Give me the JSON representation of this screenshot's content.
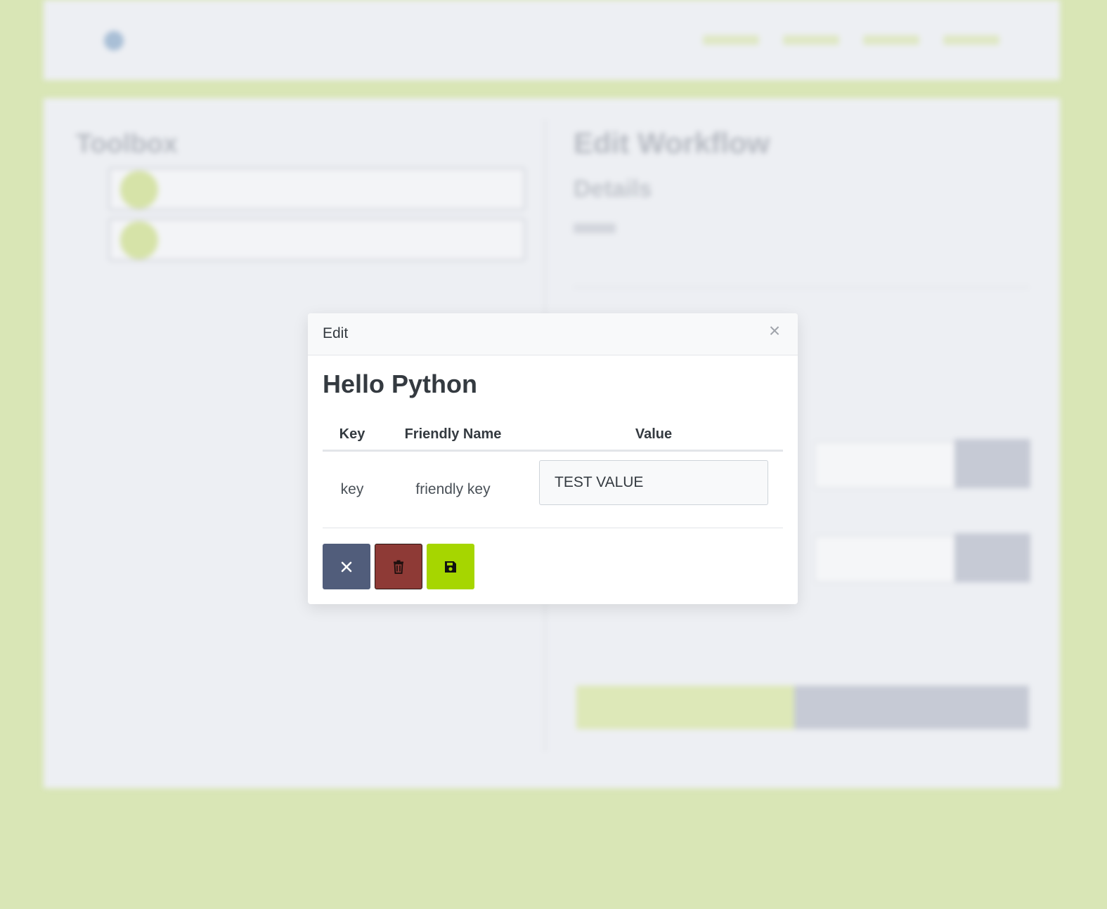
{
  "modal": {
    "title": "Edit",
    "close_symbol": "×",
    "heading": "Hello Python",
    "table": {
      "columns": [
        "Key",
        "Friendly Name",
        "Value"
      ],
      "rows": [
        {
          "key": "key",
          "friendly_name": "friendly key",
          "value": "TEST VALUE"
        }
      ]
    },
    "actions": [
      {
        "name": "cancel",
        "icon": "close-icon",
        "color": "#515d7b"
      },
      {
        "name": "delete",
        "icon": "trash-icon",
        "color": "#8e3a36"
      },
      {
        "name": "save",
        "icon": "save-icon",
        "color": "#a6d600"
      }
    ]
  },
  "background": {
    "toolbox_title": "Toolbox",
    "edit_title": "Edit Workflow",
    "details_title": "Details"
  },
  "colors": {
    "page_background": "#d9e6b6",
    "accent": "#a6d600"
  }
}
